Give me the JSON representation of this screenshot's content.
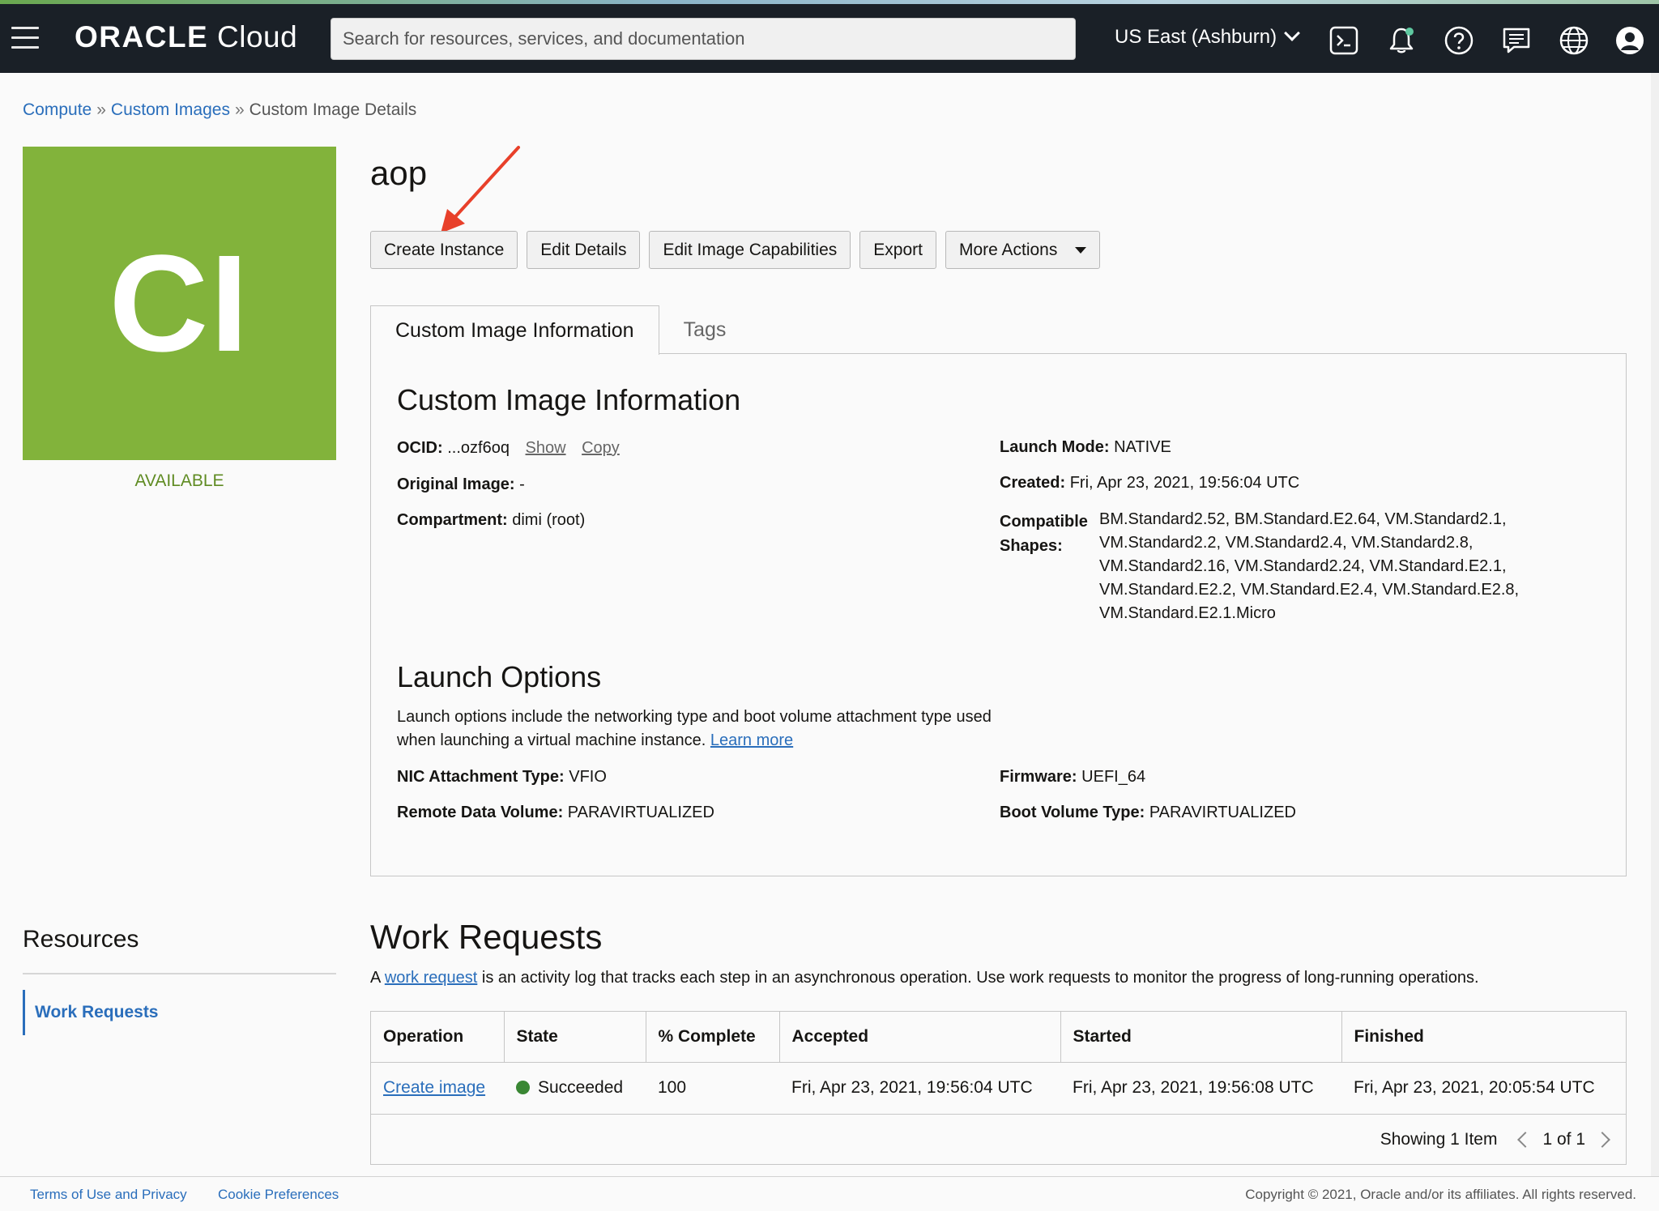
{
  "header": {
    "brand_strong": "ORACLE",
    "brand_light": "Cloud",
    "search_placeholder": "Search for resources, services, and documentation",
    "region": "US East (Ashburn)",
    "icons": [
      "terminal-icon",
      "bell-icon",
      "help-icon",
      "chat-icon",
      "globe-icon",
      "user-icon"
    ]
  },
  "breadcrumb": {
    "items": [
      "Compute",
      "Custom Images"
    ],
    "separator": "»",
    "current": "Custom Image Details"
  },
  "image": {
    "initials": "CI",
    "status": "AVAILABLE",
    "tile_color": "#82b33b",
    "title": "aop"
  },
  "actions": {
    "create_instance": "Create Instance",
    "edit_details": "Edit Details",
    "edit_capabilities": "Edit Image Capabilities",
    "export": "Export",
    "more_actions": "More Actions"
  },
  "tabs": {
    "info": "Custom Image Information",
    "tags": "Tags"
  },
  "info": {
    "heading": "Custom Image Information",
    "ocid_label": "OCID:",
    "ocid_value": "...ozf6oq",
    "show": "Show",
    "copy": "Copy",
    "original_image_label": "Original Image:",
    "original_image_value": "-",
    "compartment_label": "Compartment:",
    "compartment_value": "dimi (root)",
    "launch_mode_label": "Launch Mode:",
    "launch_mode_value": "NATIVE",
    "created_label": "Created:",
    "created_value": "Fri, Apr 23, 2021, 19:56:04 UTC",
    "shapes_label_1": "Compatible",
    "shapes_label_2": "Shapes:",
    "shapes_value": "BM.Standard2.52, BM.Standard.E2.64, VM.Standard2.1, VM.Standard2.2, VM.Standard2.4, VM.Standard2.8, VM.Standard2.16, VM.Standard2.24, VM.Standard.E2.1, VM.Standard.E2.2, VM.Standard.E2.4, VM.Standard.E2.8, VM.Standard.E2.1.Micro"
  },
  "launch": {
    "heading": "Launch Options",
    "description": "Launch options include the networking type and boot volume attachment type used when launching a virtual machine instance.",
    "learn_more": "Learn more",
    "nic_label": "NIC Attachment Type:",
    "nic_value": "VFIO",
    "remote_label": "Remote Data Volume:",
    "remote_value": "PARAVIRTUALIZED",
    "firmware_label": "Firmware:",
    "firmware_value": "UEFI_64",
    "boot_label": "Boot Volume Type:",
    "boot_value": "PARAVIRTUALIZED"
  },
  "resources": {
    "title": "Resources",
    "work_requests": "Work Requests"
  },
  "work_requests": {
    "title": "Work Requests",
    "desc_prefix": "A",
    "desc_link": "work request",
    "desc_suffix": "is an activity log that tracks each step in an asynchronous operation. Use work requests to monitor the progress of long-running operations.",
    "columns": [
      "Operation",
      "State",
      "% Complete",
      "Accepted",
      "Started",
      "Finished"
    ],
    "rows": [
      {
        "operation": "Create image",
        "state": "Succeeded",
        "complete": "100",
        "accepted": "Fri, Apr 23, 2021, 19:56:04 UTC",
        "started": "Fri, Apr 23, 2021, 19:56:08 UTC",
        "finished": "Fri, Apr 23, 2021, 20:05:54 UTC"
      }
    ],
    "showing": "Showing 1 Item",
    "page": "1 of 1"
  },
  "footer": {
    "terms": "Terms of Use and Privacy",
    "cookies": "Cookie Preferences",
    "copyright": "Copyright © 2021, Oracle and/or its affiliates. All rights reserved."
  },
  "colors": {
    "header_bg": "#1a2027",
    "link": "#2a6ebb",
    "status_green": "#5f8b22",
    "succeeded_dot": "#3a8734",
    "annotation_arrow": "#e8402a"
  }
}
